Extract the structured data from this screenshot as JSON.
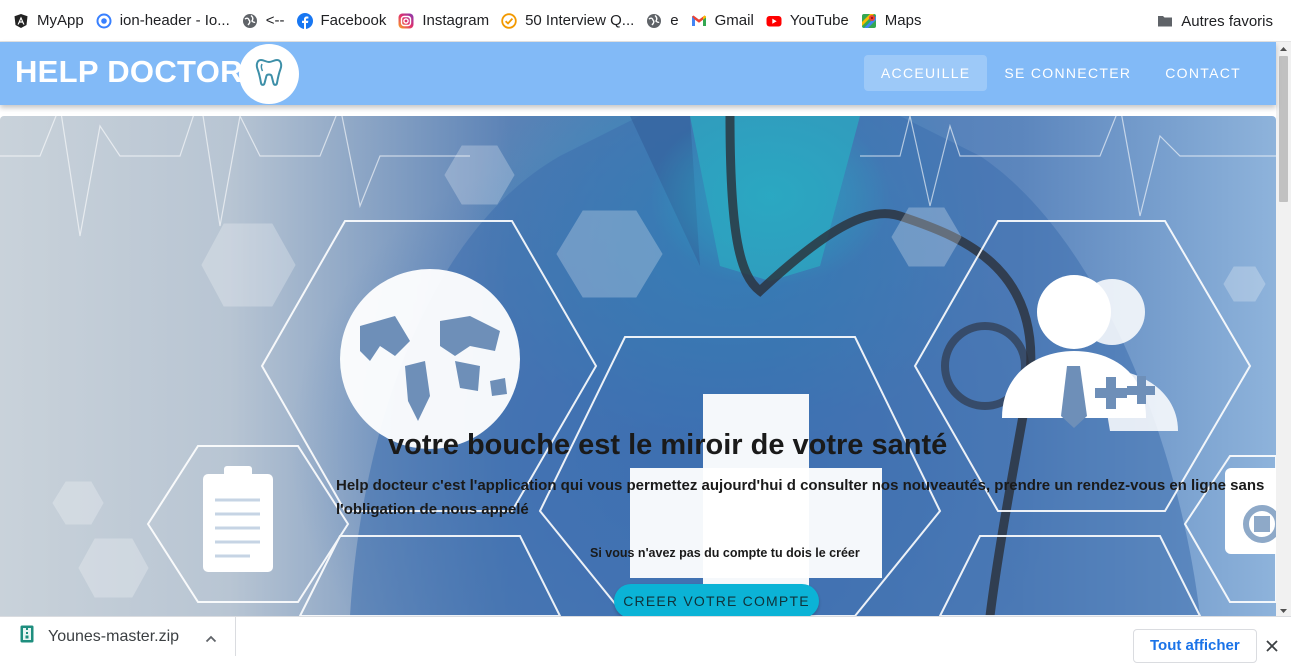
{
  "bookmarks": {
    "items": [
      {
        "label": "MyApp",
        "icon": "angular-icon"
      },
      {
        "label": "ion-header - Io...",
        "icon": "ionic-icon"
      },
      {
        "label": "<--",
        "icon": "globe-icon"
      },
      {
        "label": "Facebook",
        "icon": "facebook-icon"
      },
      {
        "label": "Instagram",
        "icon": "instagram-icon"
      },
      {
        "label": "50 Interview Q...",
        "icon": "check-circle-icon"
      },
      {
        "label": "e",
        "icon": "globe-icon"
      },
      {
        "label": "Gmail",
        "icon": "gmail-icon"
      },
      {
        "label": "YouTube",
        "icon": "youtube-icon"
      },
      {
        "label": "Maps",
        "icon": "maps-icon"
      }
    ],
    "other_label": "Autres favoris"
  },
  "header": {
    "brand": "HELP DOCTOR",
    "logo_icon": "tooth-icon",
    "nav": [
      {
        "label": "ACCEUILLE",
        "active": true
      },
      {
        "label": "SE CONNECTER",
        "active": false
      },
      {
        "label": "CONTACT",
        "active": false
      }
    ],
    "color": "#82baf7"
  },
  "hero": {
    "title": "votre bouche est le miroir de votre santé",
    "description": "Help docteur c'est l'application qui vous permettez aujourd'hui d consulter nos nouveautés, prendre un rendez-vous en ligne sans l'obligation de nous appelé",
    "note": "Si vous n'avez pas du compte tu dois le créer",
    "cta_label": "CREER VOTRE COMPTE",
    "cta_color": "#0bb3d6"
  },
  "downloads": {
    "file_name": "Younes-master.zip",
    "show_all_label": "Tout afficher"
  }
}
